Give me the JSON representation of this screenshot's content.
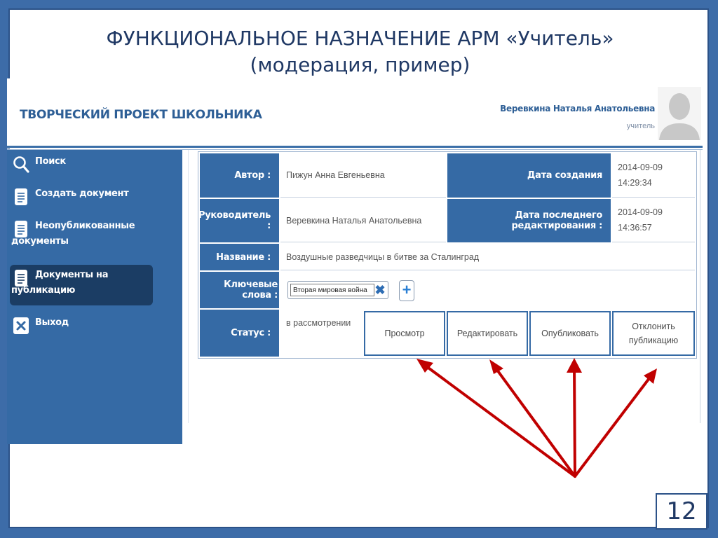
{
  "slide": {
    "title_line1": "ФУНКЦИОНАЛЬНОЕ НАЗНАЧЕНИЕ АРМ «Учитель»",
    "title_line2": "(модерация, пример)",
    "page_number": "12"
  },
  "app": {
    "title": "ТВОРЧЕСКИЙ ПРОЕКТ ШКОЛЬНИКА",
    "user_name": "Веревкина Наталья Анатольевна",
    "user_role": "учитель"
  },
  "sidebar": {
    "items": [
      {
        "label": "Поиск",
        "icon": "search-icon"
      },
      {
        "label": "Создать документ",
        "icon": "document-icon"
      },
      {
        "label": "Неопубликованные",
        "label2": "документы",
        "icon": "document-icon"
      },
      {
        "label": "Документы на",
        "label2": "публикацию",
        "icon": "document-icon",
        "active": true
      },
      {
        "label": "Выход",
        "icon": "close-icon"
      }
    ]
  },
  "form": {
    "author_label": "Автор :",
    "author_value": "Пижун Анна Евгеньевна",
    "created_label": "Дата создания",
    "created_date": "2014-09-09",
    "created_time": "14:29:34",
    "supervisor_label": "Руководитель :",
    "supervisor_value": "Веревкина Наталья Анатольевна",
    "edited_label": "Дата последнего редактирования :",
    "edited_date": "2014-09-09",
    "edited_time": "14:36:57",
    "name_label": "Название :",
    "name_value": "Воздушные разведчицы в битве за Сталинград",
    "keywords_label": "Ключевые слова :",
    "keyword_value": "Вторая мировая война",
    "status_label": "Статус :",
    "status_value": "в рассмотрении"
  },
  "actions": {
    "view": "Просмотр",
    "edit": "Редактировать",
    "publish": "Опубликовать",
    "reject_line1": "Отклонить",
    "reject_line2": "публикацию"
  },
  "colors": {
    "slide_border": "#3d6ca8",
    "sidebar": "#356aa5",
    "active_item": "#1b3d64",
    "title": "#1f3864",
    "arrows": "#c00000"
  }
}
